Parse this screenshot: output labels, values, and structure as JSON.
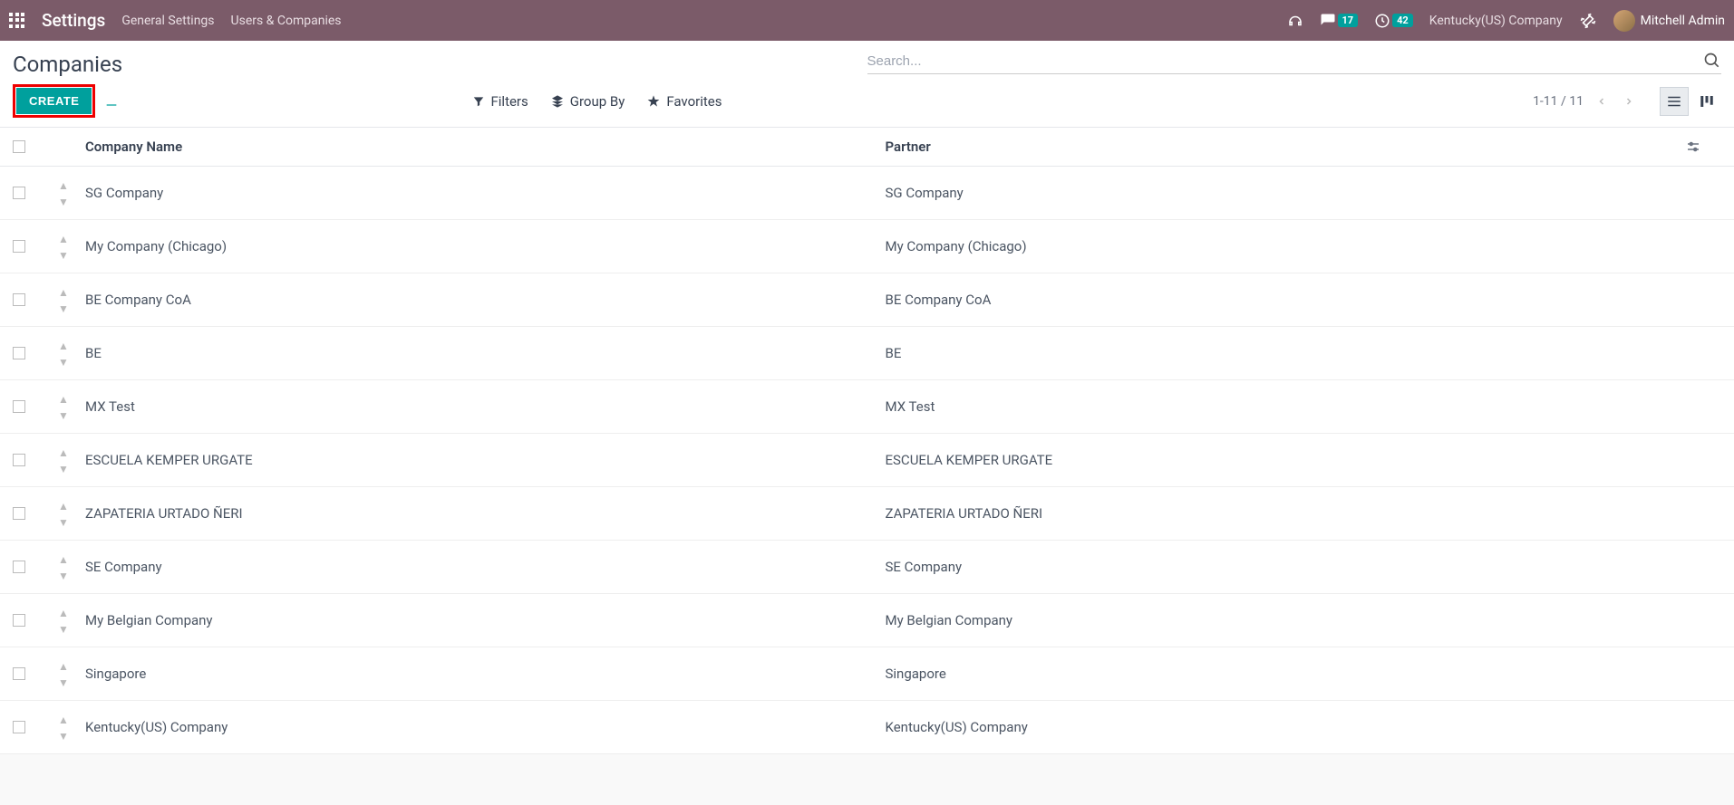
{
  "navbar": {
    "title": "Settings",
    "menu": [
      "General Settings",
      "Users & Companies"
    ],
    "messages_badge": "17",
    "activities_badge": "42",
    "company": "Kentucky(US) Company",
    "user": "Mitchell Admin"
  },
  "breadcrumb": {
    "title": "Companies"
  },
  "search": {
    "placeholder": "Search..."
  },
  "controls": {
    "create": "CREATE",
    "filters": "Filters",
    "groupby": "Group By",
    "favorites": "Favorites",
    "pager": "1-11 / 11"
  },
  "table": {
    "headers": {
      "name": "Company Name",
      "partner": "Partner"
    },
    "rows": [
      {
        "name": "SG Company",
        "partner": "SG Company"
      },
      {
        "name": "My Company (Chicago)",
        "partner": "My Company (Chicago)"
      },
      {
        "name": "BE Company CoA",
        "partner": "BE Company CoA"
      },
      {
        "name": "BE",
        "partner": "BE"
      },
      {
        "name": "MX Test",
        "partner": "MX Test"
      },
      {
        "name": "ESCUELA KEMPER URGATE",
        "partner": "ESCUELA KEMPER URGATE"
      },
      {
        "name": "ZAPATERIA URTADO ÑERI",
        "partner": "ZAPATERIA URTADO ÑERI"
      },
      {
        "name": "SE Company",
        "partner": "SE Company"
      },
      {
        "name": "My Belgian Company",
        "partner": "My Belgian Company"
      },
      {
        "name": "Singapore",
        "partner": "Singapore"
      },
      {
        "name": "Kentucky(US) Company",
        "partner": "Kentucky(US) Company"
      }
    ]
  }
}
